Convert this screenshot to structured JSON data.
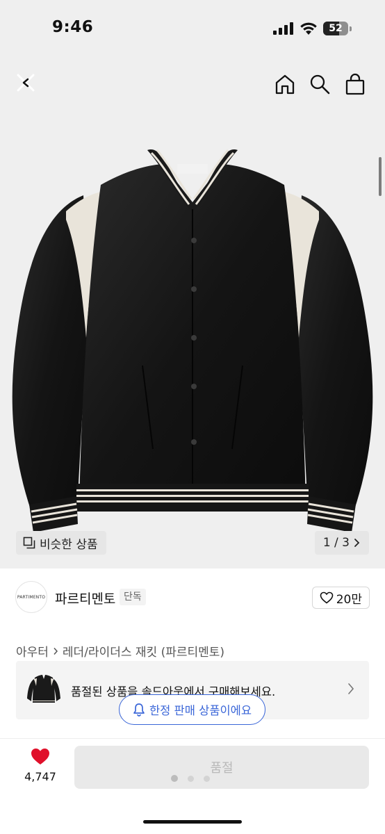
{
  "status_bar": {
    "time": "9:46",
    "battery": "52"
  },
  "top_nav": {
    "close_icon": "close-back-icon",
    "home_icon": "home-icon",
    "search_icon": "search-icon",
    "bag_icon": "shopping-bag-icon"
  },
  "gallery": {
    "similar_label": "비슷한 상품",
    "page_indicator": "1 / 3"
  },
  "brand": {
    "logo_text": "PARTIMENTO",
    "name": "파르티멘토",
    "badge": "단독",
    "likes": "20만"
  },
  "breadcrumb": {
    "category": "아우터",
    "subcategory": "레더/라이더스 재킷 (파르티멘토)"
  },
  "soldout_banner": {
    "text": "품절된 상품을 솔드아웃에서 구매해보세요."
  },
  "limited": {
    "label": "한정 판매 상품이에요"
  },
  "bottom_bar": {
    "wish_count": "4,747",
    "buy_label": "품절"
  },
  "colors": {
    "accent_blue": "#3a66d8",
    "heart_red": "#e0102a",
    "hero_bg": "#efefef"
  }
}
